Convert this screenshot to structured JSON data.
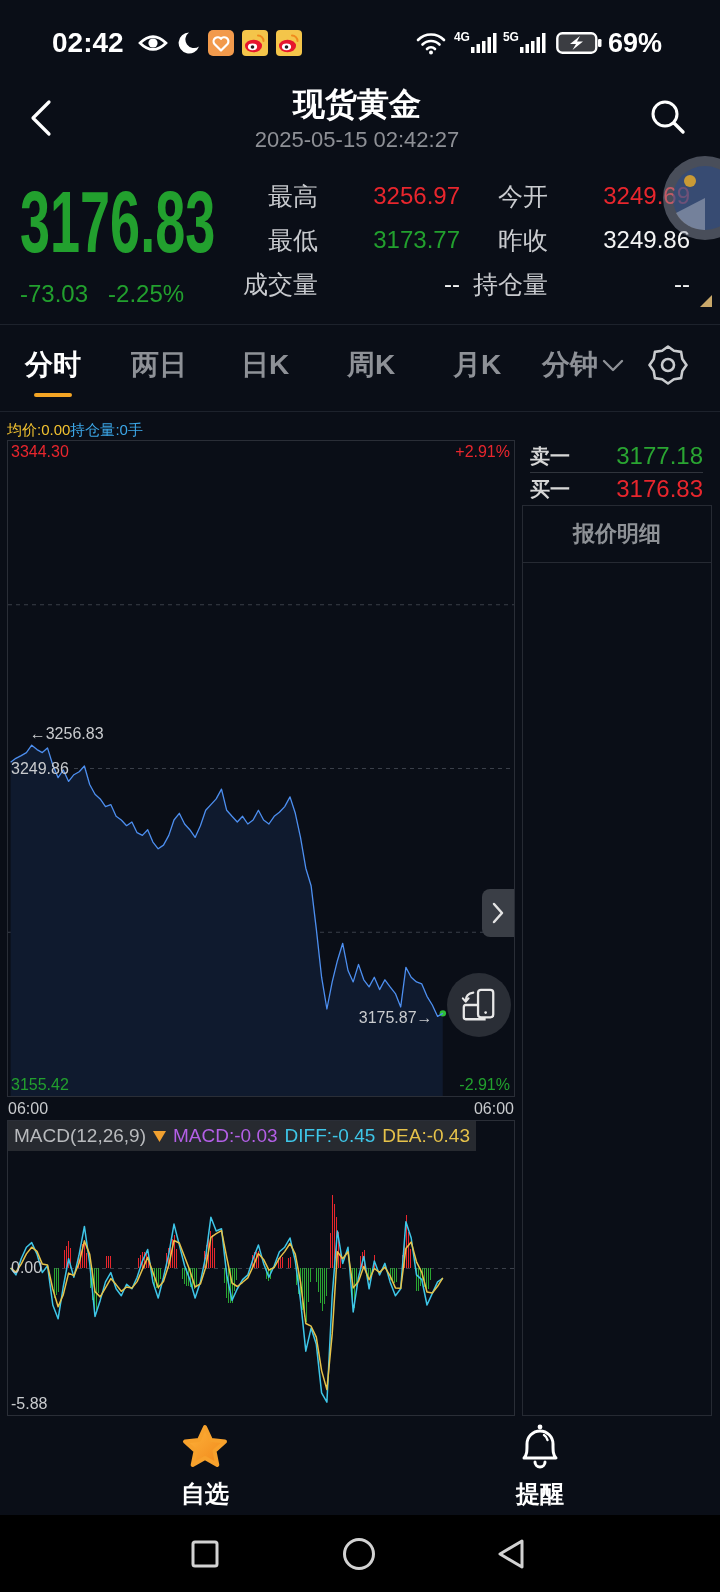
{
  "status_bar": {
    "time": "02:42",
    "networks": [
      "4G",
      "5G"
    ],
    "battery": "69%"
  },
  "header": {
    "title": "现货黄金",
    "timestamp": "2025-05-15 02:42:27"
  },
  "quote": {
    "price": "3176.83",
    "change": "-73.03",
    "change_pct": "-2.25%",
    "kind": "down",
    "stats": [
      {
        "label": "最高",
        "value": "3256.97",
        "kind": "up"
      },
      {
        "label": "今开",
        "value": "3249.69",
        "kind": "up"
      },
      {
        "label": "最低",
        "value": "3173.77",
        "kind": "down"
      },
      {
        "label": "昨收",
        "value": "3249.86",
        "kind": "flat"
      },
      {
        "label": "成交量",
        "value": "--",
        "kind": "flat"
      },
      {
        "label": "持仓量",
        "value": "--",
        "kind": "flat"
      }
    ]
  },
  "tabs": [
    {
      "label": "分时",
      "selected": true,
      "kind": "tab"
    },
    {
      "label": "两日",
      "selected": false,
      "kind": "tab"
    },
    {
      "label": "日K",
      "selected": false,
      "kind": "tab"
    },
    {
      "label": "周K",
      "selected": false,
      "kind": "tab"
    },
    {
      "label": "月K",
      "selected": false,
      "kind": "tab"
    },
    {
      "label": "分钟",
      "selected": false,
      "kind": "dropdown"
    }
  ],
  "price_chart": {
    "legend": [
      {
        "text": "均价:0.00",
        "color": "#f2c230"
      },
      {
        "text": "持仓量:0手",
        "color": "#3ca7e8"
      }
    ],
    "percent_labels": [
      "+2.91%",
      "-2.91%"
    ],
    "time_labels": [
      "06:00",
      "06:00"
    ],
    "chart_data": {
      "type": "area",
      "ylim": [
        3152.14,
        3347.58
      ],
      "yticks": [
        {
          "value": 3344.3,
          "label": "3344.30"
        },
        {
          "value": 3249.86,
          "label": "3249.86"
        },
        {
          "value": 3155.42,
          "label": "3155.42"
        }
      ],
      "series": [
        {
          "color": "#4d8ff0",
          "values": [
            3251.7,
            3252.9,
            3253.7,
            3254.6,
            3256.8,
            3255.5,
            3254.6,
            3256.0,
            3250.9,
            3247.1,
            3249.4,
            3246.0,
            3248.0,
            3248.9,
            3250.6,
            3245.1,
            3242.2,
            3240.8,
            3238.5,
            3239.1,
            3235.6,
            3234.5,
            3232.8,
            3233.9,
            3230.7,
            3229.9,
            3231.6,
            3227.9,
            3225.9,
            3227.0,
            3229.9,
            3234.5,
            3236.5,
            3233.3,
            3231.6,
            3229.3,
            3232.8,
            3237.4,
            3239.1,
            3240.8,
            3243.7,
            3237.4,
            3235.6,
            3233.9,
            3235.6,
            3233.3,
            3234.5,
            3237.4,
            3234.5,
            3233.3,
            3235.6,
            3236.8,
            3238.5,
            3241.4,
            3236.5,
            3229.3,
            3220.1,
            3214.9,
            3202.0,
            3187.6,
            3178.1,
            3186.2,
            3192.5,
            3197.7,
            3189.6,
            3186.2,
            3191.4,
            3186.8,
            3184.7,
            3187.6,
            3183.9,
            3186.8,
            3184.7,
            3182.7,
            3178.7,
            3190.5,
            3187.6,
            3186.2,
            3185.6,
            3181.9,
            3179.3,
            3175.9,
            3176.8,
            null,
            null,
            null,
            null,
            null,
            null,
            null,
            null,
            null,
            null,
            null,
            null,
            null
          ]
        }
      ],
      "annotations": [
        "←3256.83",
        "3175.87→"
      ]
    }
  },
  "macd_chart": {
    "indicator": "MACD(12,26,9)",
    "legend": [
      {
        "text": "MACD:-0.03",
        "color": "#b35fe6"
      },
      {
        "text": "DIFF:-0.45",
        "color": "#3ec6e8"
      },
      {
        "text": "DEA:-0.43",
        "color": "#e6c24a"
      }
    ],
    "chart_data": {
      "type": "line",
      "ylim": [
        -6.36,
        6.36
      ],
      "yticks": [
        {
          "value": 0,
          "label": "0.00"
        },
        {
          "value": -5.88,
          "label": "-5.88"
        }
      ],
      "series": [
        {
          "color": "#3ec6e8",
          "values": [
            0.0,
            -0.3,
            0.4,
            0.9,
            1.1,
            0.6,
            -0.2,
            0.1,
            -1.6,
            -2.2,
            -0.8,
            0.4,
            -0.4,
            0.6,
            1.8,
            0.2,
            -2.1,
            -1.4,
            -0.6,
            -0.2,
            -0.9,
            -1.2,
            -0.7,
            -0.9,
            -0.4,
            0.3,
            0.8,
            -0.6,
            -1.3,
            -0.4,
            0.6,
            1.9,
            1.0,
            0.1,
            -0.5,
            -1.3,
            -0.6,
            0.5,
            2.2,
            1.6,
            1.7,
            -0.3,
            -1.4,
            -0.9,
            -0.5,
            -0.3,
            0.4,
            1.0,
            0.2,
            -0.4,
            0.1,
            0.7,
            0.9,
            1.3,
            0.3,
            -1.4,
            -3.6,
            -2.6,
            -3.3,
            -5.4,
            -5.8,
            -1.2,
            1.6,
            0.2,
            0.9,
            -1.9,
            -0.4,
            0.5,
            -0.9,
            0.3,
            -0.3,
            0.2,
            -0.6,
            -1.2,
            -0.9,
            2.0,
            1.3,
            -0.3,
            -0.5,
            -1.6,
            -1.1,
            -0.6,
            -0.45,
            null,
            null,
            null,
            null,
            null,
            null,
            null,
            null,
            null,
            null,
            null,
            null,
            null
          ]
        },
        {
          "color": "#e6c24a",
          "values": [
            0.0,
            -0.18,
            0.17,
            0.61,
            0.9,
            0.72,
            0.17,
            0.13,
            -0.91,
            -1.68,
            -1.15,
            -0.22,
            -0.33,
            0.23,
            1.17,
            0.59,
            -1.02,
            -1.25,
            -0.86,
            -0.46,
            -0.72,
            -1.01,
            -0.82,
            -0.87,
            -0.59,
            -0.06,
            0.46,
            -0.18,
            -0.85,
            -0.58,
            0.13,
            1.19,
            1.08,
            0.49,
            -0.1,
            -0.82,
            -0.69,
            0.02,
            1.33,
            1.49,
            1.62,
            0.47,
            -0.65,
            -0.8,
            -0.62,
            -0.43,
            0.07,
            0.63,
            0.37,
            -0.09,
            0.02,
            0.43,
            0.71,
            1.06,
            0.6,
            -0.6,
            -2.4,
            -2.52,
            -2.99,
            -4.44,
            -5.26,
            -2.85,
            0.7,
            0.4,
            0.7,
            -0.86,
            -0.58,
            0.07,
            -0.51,
            -0.02,
            -0.19,
            0.04,
            -0.34,
            -0.86,
            -0.88,
            0.85,
            1.12,
            0.27,
            -0.19,
            -1.04,
            -1.08,
            -0.79,
            -0.43,
            null,
            null,
            null,
            null,
            null,
            null,
            null,
            null,
            null,
            null,
            null,
            null,
            null
          ]
        }
      ]
    }
  },
  "order_book": [
    {
      "label": "卖一",
      "price": "3177.18",
      "kind": "ask"
    },
    {
      "label": "买一",
      "price": "3176.83",
      "kind": "bid"
    }
  ],
  "quote_detail": {
    "title": "报价明细"
  },
  "bottom_nav": [
    {
      "label": "自选",
      "on": true
    },
    {
      "label": "提醒",
      "on": false
    }
  ]
}
